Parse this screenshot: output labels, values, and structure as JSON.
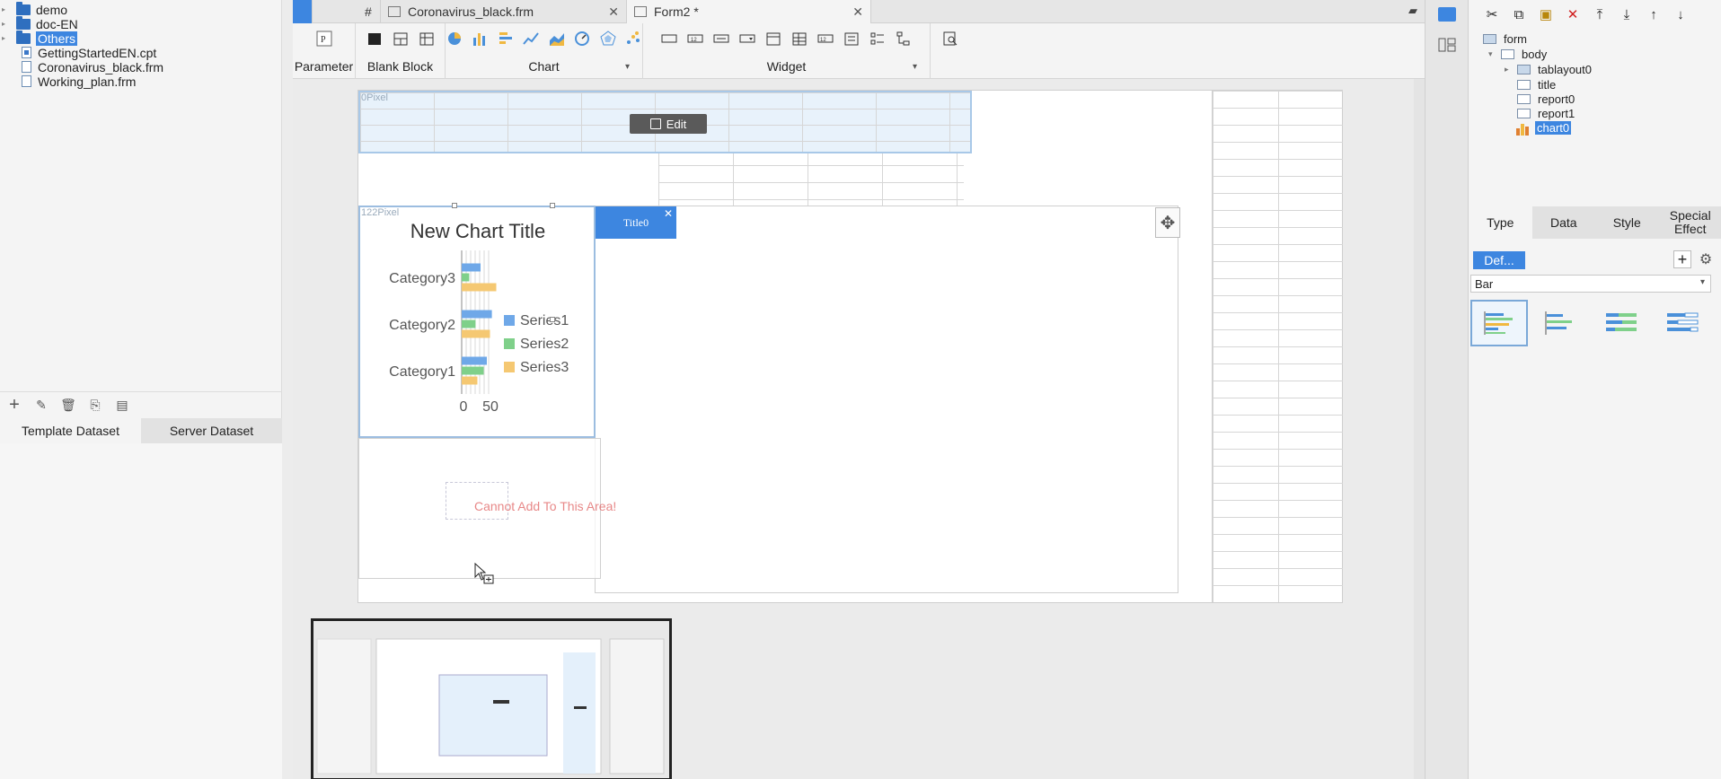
{
  "file_tree": {
    "items": [
      {
        "label": "demo",
        "kind": "folder"
      },
      {
        "label": "doc-EN",
        "kind": "folder"
      },
      {
        "label": "Others",
        "kind": "folder",
        "selected": true
      },
      {
        "label": "GettingStartedEN.cpt",
        "kind": "cpt"
      },
      {
        "label": "Coronavirus_black.frm",
        "kind": "frm"
      },
      {
        "label": "Working_plan.frm",
        "kind": "frm"
      }
    ]
  },
  "dataset_panel": {
    "tabs": [
      {
        "label": "Template Dataset",
        "active": true
      },
      {
        "label": "Server Dataset",
        "active": false
      }
    ]
  },
  "doc_tabs": [
    {
      "label": "Coronavirus_black.frm",
      "active": false
    },
    {
      "label": "Form2 *",
      "active": true
    }
  ],
  "ribbon": {
    "groups": [
      {
        "label": "Parameter"
      },
      {
        "label": "Blank Block"
      },
      {
        "label": "Chart"
      },
      {
        "label": "Widget"
      }
    ]
  },
  "canvas": {
    "top_block_px_label": "0Pixel",
    "edit_label": "Edit",
    "chart_px_label": "122Pixel",
    "title_tab_label": "Title0",
    "cannot_add_text": "Cannot Add To This Area!"
  },
  "chart_data": {
    "type": "bar",
    "orientation": "horizontal",
    "title": "New Chart Title",
    "categories": [
      "Category1",
      "Category2",
      "Category3"
    ],
    "series": [
      {
        "name": "Series1",
        "values": [
          40,
          48,
          30
        ],
        "color": "#6fa8e8"
      },
      {
        "name": "Series2",
        "values": [
          35,
          22,
          12
        ],
        "color": "#7fd08a"
      },
      {
        "name": "Series3",
        "values": [
          25,
          45,
          55
        ],
        "color": "#f5c872"
      }
    ],
    "xlim": [
      0,
      100
    ],
    "x_ticks": [
      "0",
      "50"
    ],
    "legend_position": "right"
  },
  "widget_tree": {
    "root": "form",
    "body": "body",
    "children": [
      "tablayout0",
      "title",
      "report0",
      "report1",
      "chart0"
    ],
    "selected": "chart0"
  },
  "properties": {
    "tabs": [
      {
        "label": "Type",
        "active": true
      },
      {
        "label": "Data",
        "active": false
      },
      {
        "label": "Style",
        "active": false
      },
      {
        "label": "Special Effect",
        "active": false
      }
    ],
    "default_button": "Def...",
    "chart_type": "Bar"
  },
  "colors": {
    "accent": "#3d86e0",
    "warning_text": "#e06060"
  }
}
